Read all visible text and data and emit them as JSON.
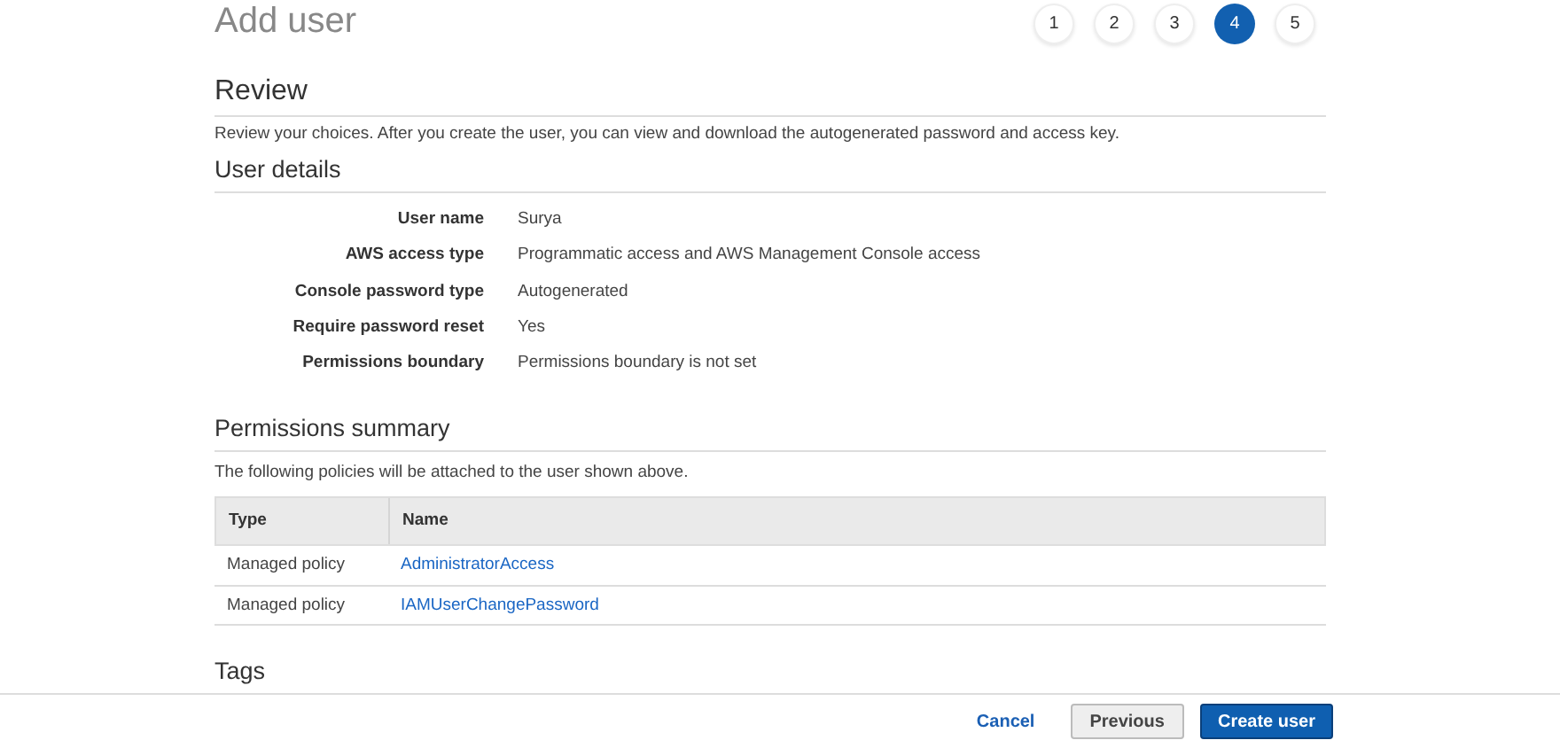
{
  "page_title": "Add user",
  "steps": [
    {
      "label": "1",
      "selected": false
    },
    {
      "label": "2",
      "selected": false
    },
    {
      "label": "3",
      "selected": false
    },
    {
      "label": "4",
      "selected": true
    },
    {
      "label": "5",
      "selected": false
    }
  ],
  "review": {
    "heading": "Review",
    "description": "Review your choices. After you create the user, you can view and download the autogenerated password and access key."
  },
  "user_details": {
    "heading": "User details",
    "rows": [
      {
        "label": "User name",
        "value": "Surya"
      },
      {
        "label": "AWS access type",
        "value": "Programmatic access and AWS Management Console access"
      },
      {
        "label": "Console password type",
        "value": "Autogenerated"
      },
      {
        "label": "Require password reset",
        "value": "Yes"
      },
      {
        "label": "Permissions boundary",
        "value": "Permissions boundary is not set"
      }
    ]
  },
  "permissions_summary": {
    "heading": "Permissions summary",
    "description": "The following policies will be attached to the user shown above.",
    "columns": [
      "Type",
      "Name"
    ],
    "rows": [
      {
        "type": "Managed policy",
        "name": "AdministratorAccess"
      },
      {
        "type": "Managed policy",
        "name": "IAMUserChangePassword"
      }
    ]
  },
  "tags": {
    "heading": "Tags"
  },
  "footer": {
    "cancel": "Cancel",
    "previous": "Previous",
    "create": "Create user"
  }
}
